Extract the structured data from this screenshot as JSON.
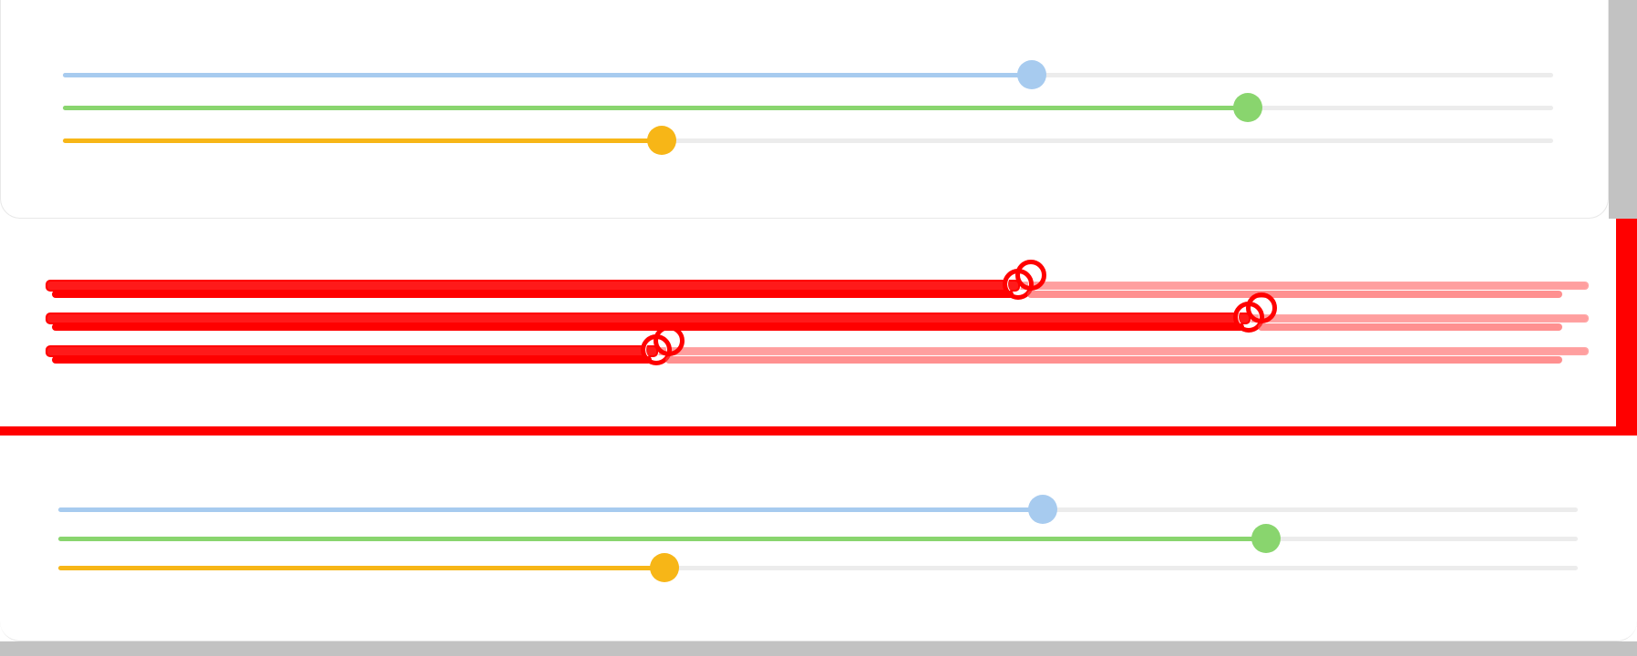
{
  "colors": {
    "blue": "#a7cbef",
    "green": "#89d56e",
    "orange": "#f7b617",
    "rail": "#ececec",
    "highlight": "#ff0000",
    "gutter": "#c2c2c2"
  },
  "panels": [
    {
      "name": "panel-top",
      "sliders": [
        {
          "name": "slider-blue",
          "color": "blue",
          "value": 0.65
        },
        {
          "name": "slider-green",
          "color": "green",
          "value": 0.795
        },
        {
          "name": "slider-orange",
          "color": "orange",
          "value": 0.402
        }
      ]
    },
    {
      "name": "panel-highlighted",
      "sliders": [
        {
          "name": "slider-blue",
          "color": "highlight",
          "value": 0.63
        },
        {
          "name": "slider-green",
          "color": "highlight",
          "value": 0.78
        },
        {
          "name": "slider-orange",
          "color": "highlight",
          "value": 0.395
        }
      ]
    },
    {
      "name": "panel-bottom",
      "sliders": [
        {
          "name": "slider-blue",
          "color": "blue",
          "value": 0.648
        },
        {
          "name": "slider-green",
          "color": "green",
          "value": 0.795
        },
        {
          "name": "slider-orange",
          "color": "orange",
          "value": 0.399
        }
      ]
    }
  ]
}
